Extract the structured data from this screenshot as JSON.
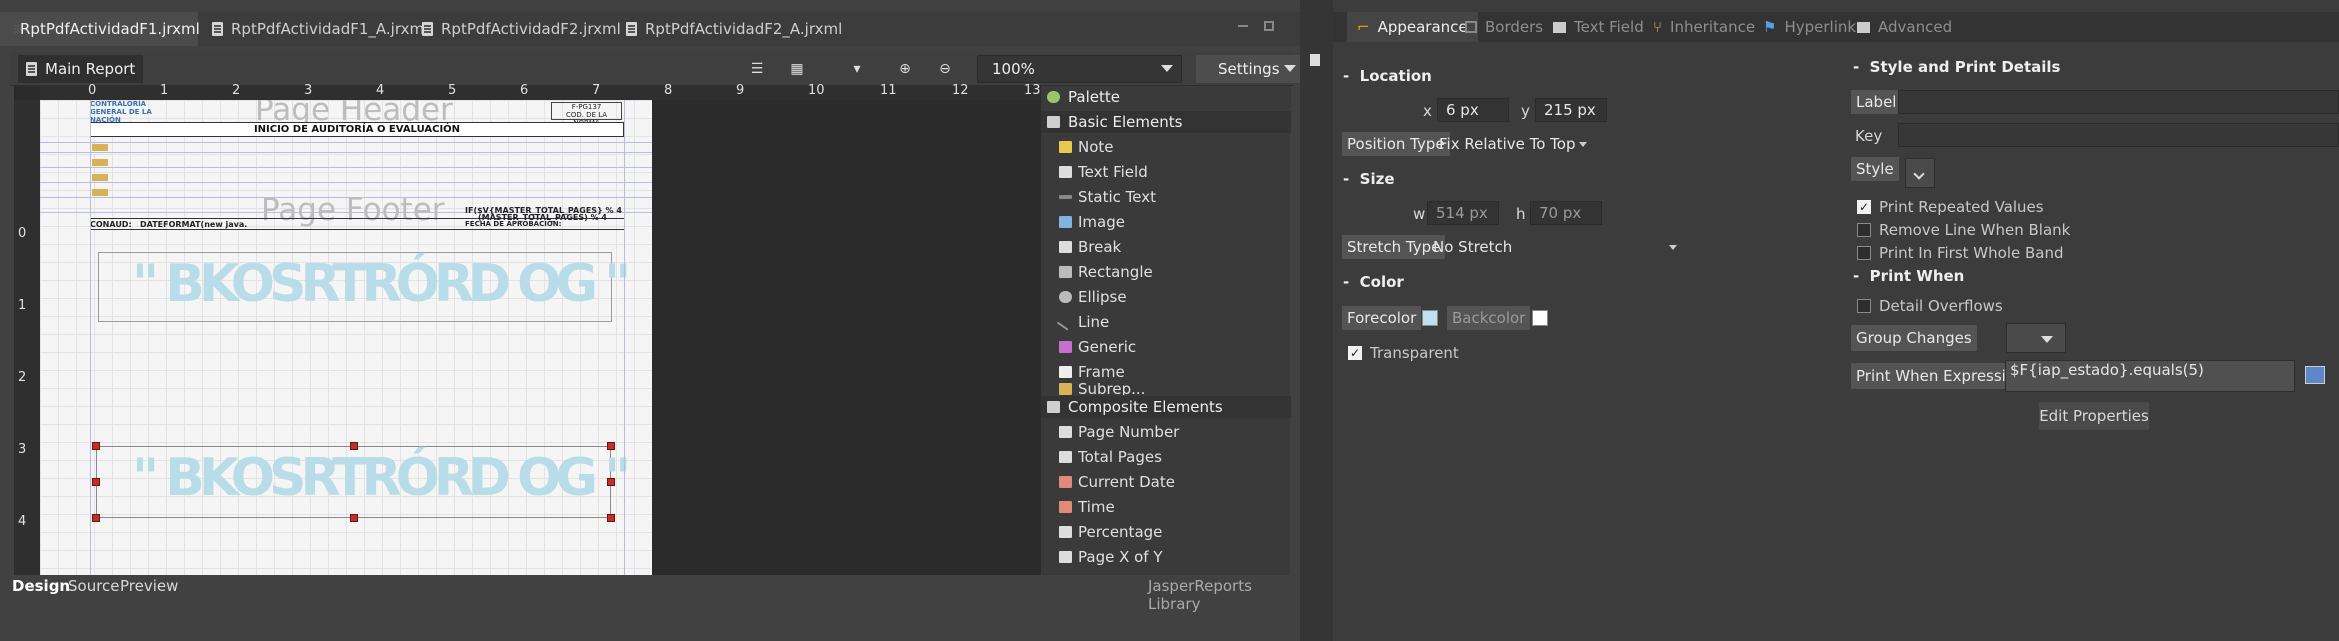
{
  "file_tabs": [
    {
      "label": "RptPdfActividadF1.jrxml",
      "active": true
    },
    {
      "label": "RptPdfActividadF1_A.jrxml",
      "active": false
    },
    {
      "label": "RptPdfActividadF2.jrxml",
      "active": false
    },
    {
      "label": "RptPdfActividadF2_A.jrxml",
      "active": false
    }
  ],
  "toolbar": {
    "main_report": "Main Report",
    "zoom": "100%",
    "settings": "Settings"
  },
  "rulers": {
    "h_ticks": [
      "0",
      "1",
      "2",
      "3",
      "4",
      "5",
      "6",
      "7",
      "8",
      "9",
      "10",
      "11",
      "12",
      "13"
    ],
    "v_ticks": [
      "0",
      "1",
      "2",
      "3",
      "4"
    ]
  },
  "report": {
    "title": "INICIO DE AUDITORÍA O EVALUACIÓN",
    "page_header_label": "Page Header",
    "page_footer_label": "Page Footer",
    "code_top": "F-PG137",
    "code_label": "COD. DE LA NORMA",
    "footer_left": "CONAUD:",
    "footer_date": "DATEFORMAT(new java.",
    "footer_pages": "IF($V{MASTER_TOTAL_PAGES} % 4",
    "footer_pages2": "(MASTER_TOTAL_PAGES) % 4",
    "footer_fecha": "FECHA DE APROBACIÓN:",
    "ghost_text": "\" BKOSRTRÓRD OG \"",
    "mini_logo": "CONTRALORÍA GENERAL DE LA NACIÓN"
  },
  "palette": {
    "title": "Palette",
    "basic_header": "Basic Elements",
    "basic": [
      "Note",
      "Text Field",
      "Static Text",
      "Image",
      "Break",
      "Rectangle",
      "Ellipse",
      "Line",
      "Generic",
      "Frame",
      "Subrep..."
    ],
    "composite_header": "Composite Elements",
    "composite": [
      "Page Number",
      "Total Pages",
      "Current Date",
      "Time",
      "Percentage",
      "Page X of Y"
    ]
  },
  "bottom_tabs": [
    "Design",
    "Source",
    "Preview"
  ],
  "library_label": "JasperReports Library",
  "prop_tabs": [
    "Appearance",
    "Borders",
    "Text Field",
    "Inheritance",
    "Hyperlink",
    "Advanced"
  ],
  "location": {
    "header": "Location",
    "x_label": "x",
    "x": "6 px",
    "y_label": "y",
    "y": "215 px",
    "position_type_label": "Position Type",
    "position_type": "Fix Relative To Top"
  },
  "size": {
    "header": "Size",
    "w_label": "w",
    "w": "514 px",
    "h_label": "h",
    "h": "70 px",
    "stretch_type_label": "Stretch Type",
    "stretch_type": "No Stretch"
  },
  "color": {
    "header": "Color",
    "forecolor_label": "Forecolor",
    "forecolor": "#bfe0f0",
    "backcolor_label": "Backcolor",
    "backcolor": "#ffffff",
    "transparent": "Transparent"
  },
  "style_print": {
    "header": "Style and Print Details",
    "label": "Label",
    "key": "Key",
    "style": "Style",
    "print_repeated": "Print Repeated Values",
    "remove_line": "Remove Line When Blank",
    "print_first": "Print In First Whole Band"
  },
  "print_when": {
    "header": "Print When",
    "detail_overflows": "Detail Overflows",
    "group_changes": "Group Changes",
    "expression_label": "Print When Expression",
    "expression": "$F{iap_estado}.equals(5)",
    "edit_properties": "Edit Properties"
  }
}
